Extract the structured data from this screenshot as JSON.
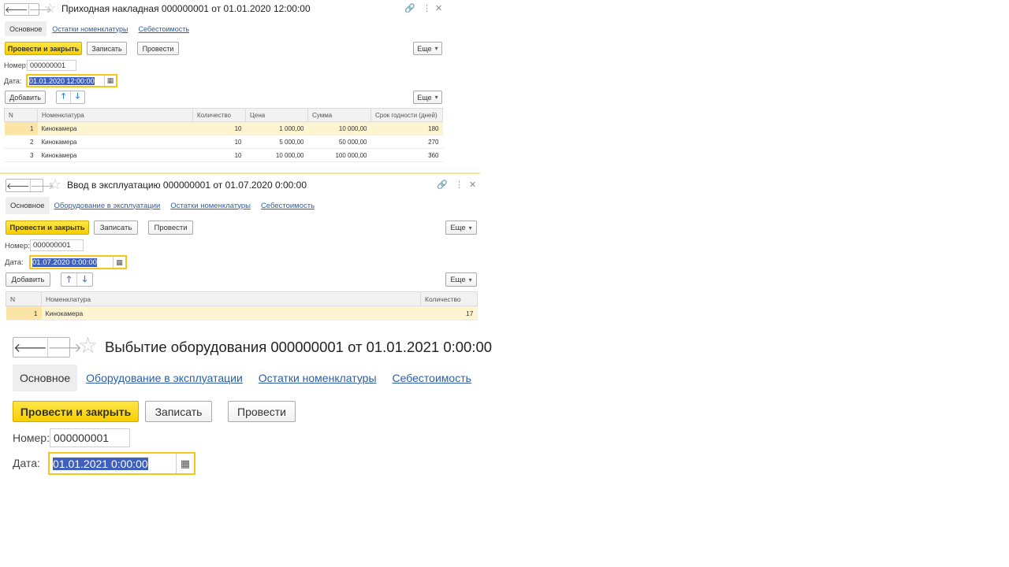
{
  "window1": {
    "title": "Приходная накладная 000000001 от 01.01.2020 12:00:00",
    "tabs": {
      "main": "Основное",
      "links": [
        "Остатки номенклатуры",
        "Себестоимость"
      ]
    },
    "buttons": {
      "post_close": "Провести и закрыть",
      "save": "Записать",
      "post": "Провести",
      "more": "Еще",
      "add": "Добавить"
    },
    "number_label": "Номер:",
    "number_value": "000000001",
    "date_label": "Дата:",
    "date_value": "01.01.2020 12:00:00",
    "table": {
      "headers": [
        "N",
        "Номенклатура",
        "Количество",
        "Цена",
        "Сумма",
        "Срок годности (дней)"
      ],
      "rows": [
        [
          "1",
          "Кинокамера",
          "10",
          "1 000,00",
          "10 000,00",
          "180"
        ],
        [
          "2",
          "Кинокамера",
          "10",
          "5 000,00",
          "50 000,00",
          "270"
        ],
        [
          "3",
          "Кинокамера",
          "10",
          "10 000,00",
          "100 000,00",
          "360"
        ]
      ]
    }
  },
  "window2": {
    "title": "Ввод в эксплуатацию 000000001 от 01.07.2020 0:00:00",
    "tabs": {
      "main": "Основное",
      "links": [
        "Оборудование в эксплуатации",
        "Остатки номенклатуры",
        "Себестоимость"
      ]
    },
    "buttons": {
      "post_close": "Провести и закрыть",
      "save": "Записать",
      "post": "Провести",
      "more": "Еще",
      "add": "Добавить"
    },
    "number_label": "Номер:",
    "number_value": "000000001",
    "date_label": "Дата:",
    "date_value": "01.07.2020  0:00:00",
    "table": {
      "headers": [
        "N",
        "Номенклатура",
        "Количество"
      ],
      "rows": [
        [
          "1",
          "Кинокамера",
          "17"
        ]
      ]
    }
  },
  "window3": {
    "title": "Выбытие оборудования 000000001 от 01.01.2021 0:00:00",
    "tabs": {
      "main": "Основное",
      "links": [
        "Оборудование в эксплуатации",
        "Остатки номенклатуры",
        "Себестоимость"
      ]
    },
    "buttons": {
      "post_close": "Провести и закрыть",
      "save": "Записать",
      "post": "Провести"
    },
    "number_label": "Номер:",
    "number_value": "000000001",
    "date_label": "Дата:",
    "date_value": "01.01.2021  0:00:00"
  },
  "icons": {
    "back": "back-arrow-icon",
    "forward": "forward-arrow-icon",
    "favorite": "star-icon",
    "link": "link-icon",
    "menu": "more-vertical-icon",
    "close": "close-icon",
    "calendar": "calendar-icon",
    "up": "move-up-icon",
    "down": "move-down-icon"
  },
  "colors": {
    "primary_button": "#f6cf00",
    "link": "#2a5ea8",
    "focus_border": "#f5c518",
    "selection": "#3e5fbd",
    "selected_row": "#fff4d1"
  }
}
